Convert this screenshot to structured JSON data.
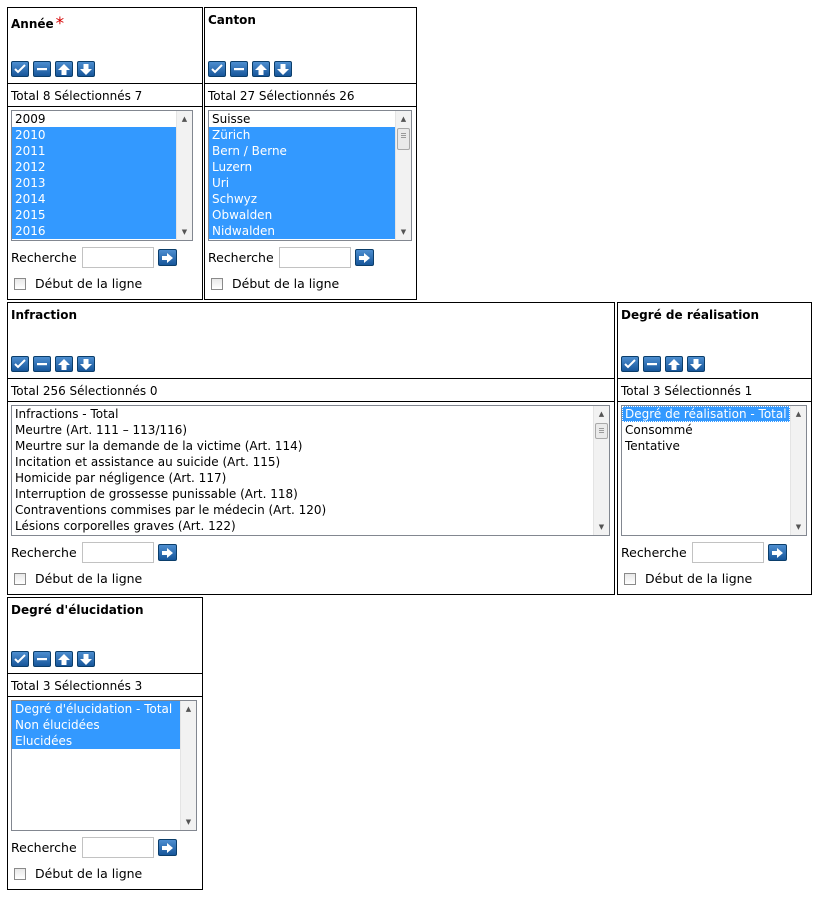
{
  "common": {
    "search_label": "Recherche",
    "start_of_line_label": "Début de la ligne",
    "search_value": ""
  },
  "colors": {
    "selection": "#3399ff",
    "required_marker": "#d40000",
    "button_blue": "#2a6db5"
  },
  "icons": [
    "select-all-icon",
    "deselect-all-icon",
    "move-up-icon",
    "move-down-icon",
    "search-go-icon"
  ],
  "panels": {
    "annee": {
      "title": "Année",
      "required_marker": "*",
      "total_line": "Total 8 Sélectionnés 7",
      "items": [
        {
          "label": "2009",
          "selected": false
        },
        {
          "label": "2010",
          "selected": true
        },
        {
          "label": "2011",
          "selected": true
        },
        {
          "label": "2012",
          "selected": true
        },
        {
          "label": "2013",
          "selected": true
        },
        {
          "label": "2014",
          "selected": true
        },
        {
          "label": "2015",
          "selected": true
        },
        {
          "label": "2016",
          "selected": true
        }
      ]
    },
    "canton": {
      "title": "Canton",
      "total_line": "Total 27 Sélectionnés 26",
      "items": [
        {
          "label": "Suisse",
          "selected": false
        },
        {
          "label": "Zürich",
          "selected": true
        },
        {
          "label": "Bern / Berne",
          "selected": true
        },
        {
          "label": "Luzern",
          "selected": true
        },
        {
          "label": "Uri",
          "selected": true
        },
        {
          "label": "Schwyz",
          "selected": true
        },
        {
          "label": "Obwalden",
          "selected": true
        },
        {
          "label": "Nidwalden",
          "selected": true
        }
      ]
    },
    "infraction": {
      "title": "Infraction",
      "total_line": "Total 256 Sélectionnés 0",
      "items": [
        {
          "label": "Infractions - Total",
          "selected": false
        },
        {
          "label": "Meurtre (Art. 111 – 113/116)",
          "selected": false
        },
        {
          "label": "Meurtre sur la demande de la victime (Art. 114)",
          "selected": false
        },
        {
          "label": "Incitation et assistance au suicide (Art. 115)",
          "selected": false
        },
        {
          "label": "Homicide par négligence (Art. 117)",
          "selected": false
        },
        {
          "label": "Interruption de grossesse punissable (Art. 118)",
          "selected": false
        },
        {
          "label": "Contraventions commises par le médecin (Art. 120)",
          "selected": false
        },
        {
          "label": "Lésions corporelles graves (Art. 122)",
          "selected": false
        }
      ]
    },
    "realisation": {
      "title": "Degré de réalisation",
      "total_line": "Total 3 Sélectionnés 1",
      "items": [
        {
          "label": "Degré de réalisation - Total",
          "selected": true
        },
        {
          "label": "Consommé",
          "selected": false
        },
        {
          "label": "Tentative",
          "selected": false
        }
      ]
    },
    "elucidation": {
      "title": "Degré d'élucidation",
      "total_line": "Total 3 Sélectionnés 3",
      "items": [
        {
          "label": "Degré d'élucidation - Total",
          "selected": true
        },
        {
          "label": "Non élucidées",
          "selected": true
        },
        {
          "label": "Elucidées",
          "selected": true
        }
      ]
    }
  }
}
